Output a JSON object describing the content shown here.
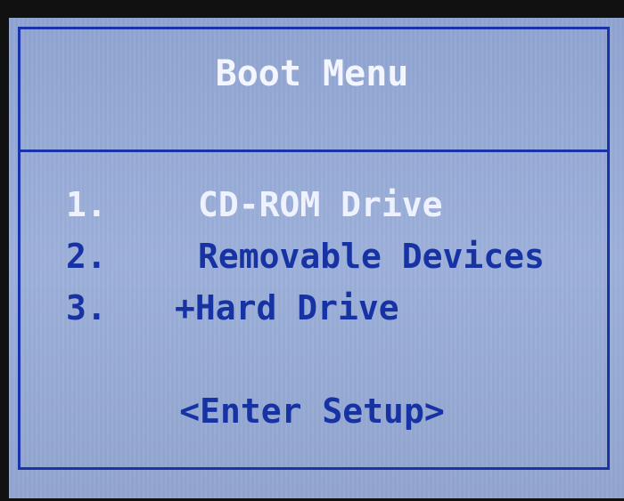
{
  "boot_menu": {
    "title": "Boot Menu",
    "items": [
      {
        "number": "1.",
        "label": "CD-ROM Drive",
        "selected": true
      },
      {
        "number": "2.",
        "label": "Removable Devices",
        "selected": false
      },
      {
        "number": "3.",
        "label": "+Hard Drive",
        "selected": false
      }
    ],
    "setup_label": "<Enter Setup>"
  },
  "colors": {
    "border": "#1a33a8",
    "text": "#1632a3",
    "highlight_text": "#eef2ff",
    "background": "#95a9d4"
  }
}
